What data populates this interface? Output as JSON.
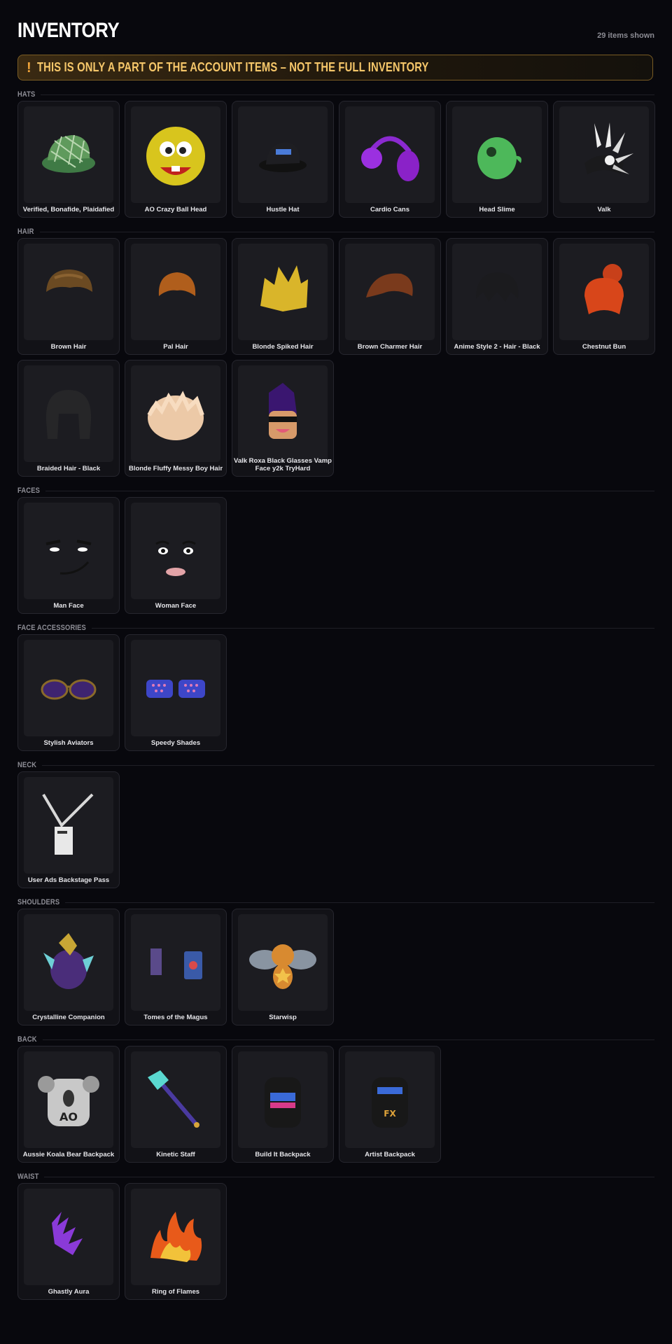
{
  "header": {
    "title": "INVENTORY",
    "count": "29 items shown"
  },
  "warning": {
    "icon": "!",
    "text": "THIS IS ONLY A PART OF THE ACCOUNT ITEMS – NOT THE FULL INVENTORY"
  },
  "sections": {
    "hats": {
      "label": "HATS",
      "items": [
        {
          "name": "Verified, Bonafide, Plaidafied",
          "icon": "plaid-cap-icon"
        },
        {
          "name": "AO Crazy Ball Head",
          "icon": "tennis-ball-head-icon"
        },
        {
          "name": "Hustle Hat",
          "icon": "black-cap-icon"
        },
        {
          "name": "Cardio Cans",
          "icon": "purple-earmuffs-icon"
        },
        {
          "name": "Head Slime",
          "icon": "green-slime-icon"
        },
        {
          "name": "Valk",
          "icon": "valkyrie-helm-icon"
        }
      ]
    },
    "hair": {
      "label": "HAIR",
      "items": [
        {
          "name": "Brown Hair",
          "icon": "brown-hair-icon"
        },
        {
          "name": "Pal Hair",
          "icon": "pal-hair-icon"
        },
        {
          "name": "Blonde Spiked Hair",
          "icon": "blonde-spiked-hair-icon"
        },
        {
          "name": "Brown Charmer Hair",
          "icon": "brown-charmer-hair-icon"
        },
        {
          "name": "Anime Style 2 - Hair - Black",
          "icon": "black-anime-hair-icon"
        },
        {
          "name": "Chestnut Bun",
          "icon": "chestnut-bun-icon"
        },
        {
          "name": "Braided Hair - Black",
          "icon": "braided-hair-icon"
        },
        {
          "name": "Blonde Fluffy Messy Boy Hair",
          "icon": "blonde-fluffy-hair-icon"
        },
        {
          "name": "Valk Roxa Black Glasses Vamp Face y2k TryHard",
          "icon": "vamp-avatar-icon"
        }
      ]
    },
    "faces": {
      "label": "FACES",
      "items": [
        {
          "name": "Man Face",
          "icon": "man-face-icon"
        },
        {
          "name": "Woman Face",
          "icon": "woman-face-icon"
        }
      ]
    },
    "face_accessories": {
      "label": "FACE ACCESSORIES",
      "items": [
        {
          "name": "Stylish Aviators",
          "icon": "aviators-icon"
        },
        {
          "name": "Speedy Shades",
          "icon": "shutter-shades-icon"
        }
      ]
    },
    "neck": {
      "label": "NECK",
      "items": [
        {
          "name": "User Ads Backstage Pass",
          "icon": "backstage-pass-icon"
        }
      ]
    },
    "shoulders": {
      "label": "SHOULDERS",
      "items": [
        {
          "name": "Crystalline Companion",
          "icon": "crystal-creature-icon"
        },
        {
          "name": "Tomes of the Magus",
          "icon": "floating-books-icon"
        },
        {
          "name": "Starwisp",
          "icon": "starwisp-icon"
        }
      ]
    },
    "back": {
      "label": "BACK",
      "items": [
        {
          "name": "Aussie Koala Bear Backpack",
          "icon": "koala-backpack-icon"
        },
        {
          "name": "Kinetic Staff",
          "icon": "magic-staff-icon"
        },
        {
          "name": "Build It Backpack",
          "icon": "black-backpack-icon"
        },
        {
          "name": "Artist Backpack",
          "icon": "artist-backpack-icon"
        }
      ]
    },
    "waist": {
      "label": "WAIST",
      "items": [
        {
          "name": "Ghastly Aura",
          "icon": "purple-aura-icon"
        },
        {
          "name": "Ring of Flames",
          "icon": "flames-icon"
        }
      ]
    }
  }
}
